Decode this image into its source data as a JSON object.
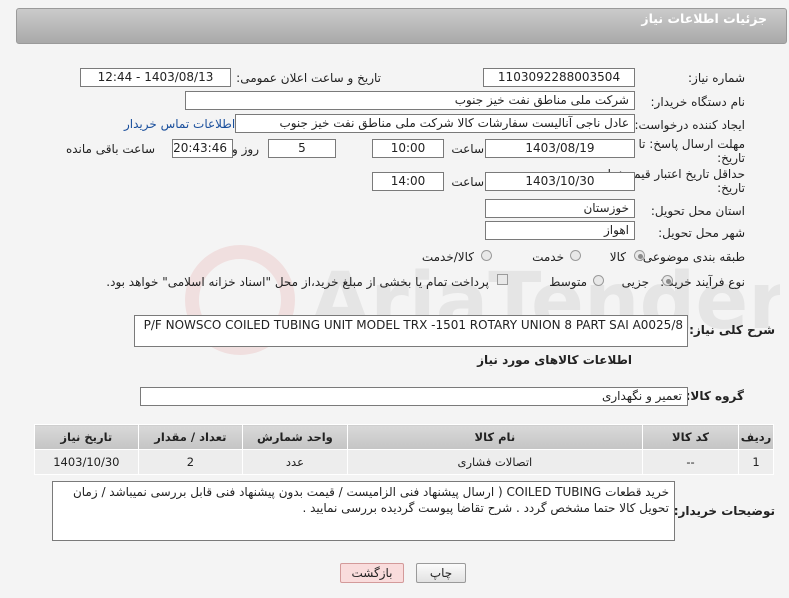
{
  "header": {
    "title": "جزئیات اطلاعات نیاز"
  },
  "form": {
    "need_number": {
      "label": "شماره نیاز:",
      "value": "1103092288003504"
    },
    "announce_datetime": {
      "label": "تاریخ و ساعت اعلان عمومی:",
      "value": "1403/08/13 - 12:44"
    },
    "buyer_org": {
      "label": "نام دستگاه خریدار:",
      "value": "شرکت ملی مناطق نفت خیز جنوب"
    },
    "requester": {
      "label": "ایجاد کننده درخواست:",
      "value": "عادل  ناجی آنالیست سفارشات کالا  شرکت ملی مناطق نفت خیز جنوب",
      "contact_link": "اطلاعات تماس خریدار"
    },
    "deadline": {
      "label_line1": "مهلت ارسال پاسخ: تا",
      "label_line2": "تاریخ:",
      "date": "1403/08/19",
      "time_label": "ساعت",
      "time": "10:00",
      "days": "5",
      "days_label": "روز و",
      "remaining": "20:43:46",
      "remaining_label": "ساعت باقی مانده"
    },
    "price_validity": {
      "label_line1": "حداقل تاریخ اعتبار قیمت: تا",
      "label_line2": "تاریخ:",
      "date": "1403/10/30",
      "time_label": "ساعت",
      "time": "14:00"
    },
    "province": {
      "label": "استان محل تحویل:",
      "value": "خوزستان"
    },
    "city": {
      "label": "شهر محل تحویل:",
      "value": "اهواز"
    },
    "category": {
      "label": "طبقه بندی موضوعی:",
      "options": [
        "کالا",
        "خدمت",
        "کالا/خدمت"
      ],
      "selected": "کالا"
    },
    "purchase_type": {
      "label": "نوع فرآیند خرید :",
      "options": [
        "جزیی",
        "متوسط"
      ],
      "selected": "جزیی",
      "payment_note": "پرداخت تمام یا بخشی از مبلغ خرید،از محل \"اسناد خزانه اسلامی\" خواهد بود."
    }
  },
  "summary": {
    "label": "شرح کلی نیاز:",
    "value": "P/F NOWSCO COILED TUBING UNIT MODEL TRX -1501 ROTARY UNION 8 PART  SAI A0025/8"
  },
  "goods_section": {
    "title": "اطلاعات کالاهای مورد نیاز",
    "group_label": "گروه کالا:",
    "group_value": "تعمیر و نگهداری",
    "columns": [
      "ردیف",
      "کد کالا",
      "نام کالا",
      "واحد شمارش",
      "تعداد / مقدار",
      "تاریخ نیاز"
    ],
    "rows": [
      [
        "1",
        "--",
        "اتصالات فشاری",
        "عدد",
        "2",
        "1403/10/30"
      ]
    ]
  },
  "buyer_notes": {
    "label": "توضیحات خریدار:",
    "value": "خرید قطعات COILED TUBING ( ارسال پیشنهاد فنی الزامیست / قیمت بدون پیشنهاد فنی قابل بررسی نمیباشد / زمان تحویل کالا حتما مشخص گردد . شرح تقاضا پیوست گردیده بررسی نمایید ."
  },
  "buttons": {
    "print": "چاپ",
    "back": "بازگشت"
  },
  "watermark": "AriaTender.net"
}
